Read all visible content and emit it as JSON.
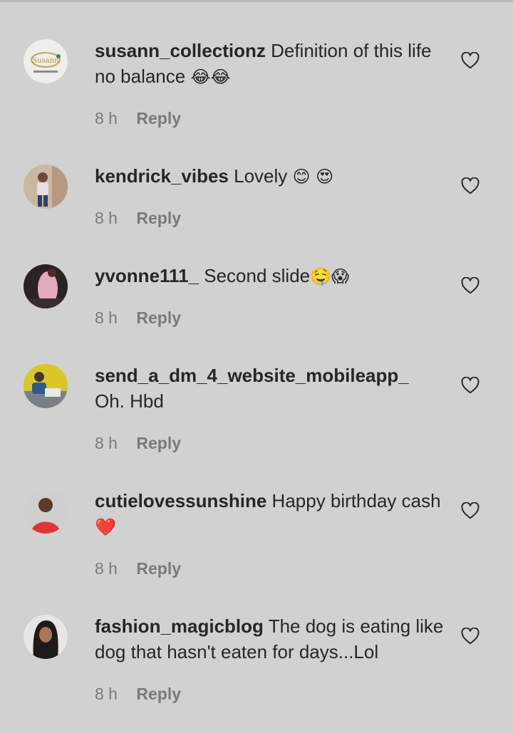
{
  "comments": [
    {
      "username": "susann_collectionz",
      "text": "Definition of this life no balance",
      "emoji": "😂😂",
      "time": "8 h",
      "reply_label": "Reply"
    },
    {
      "username": "kendrick_vibes",
      "text": "Lovely",
      "emoji": "😊 😍",
      "time": "8 h",
      "reply_label": "Reply"
    },
    {
      "username": "yvonne111_",
      "text": "Second slide",
      "emoji": "🤤😱",
      "time": "8 h",
      "reply_label": "Reply"
    },
    {
      "username": "send_a_dm_4_website_mobileapp_",
      "text": "Oh. Hbd",
      "emoji": "",
      "time": "8 h",
      "reply_label": "Reply"
    },
    {
      "username": "cutielovessunshine",
      "text": "Happy birthday cash",
      "emoji": "❤️",
      "time": "8 h",
      "reply_label": "Reply"
    },
    {
      "username": "fashion_magicblog",
      "text": "The dog is eating like dog that hasn't eaten for days...Lol",
      "emoji": "",
      "time": "8 h",
      "reply_label": "Reply"
    }
  ],
  "icons": {
    "like": "heart-outline-icon"
  },
  "colors": {
    "background": "#d1d1d1",
    "text": "#262626",
    "meta": "#7a7a7a"
  }
}
